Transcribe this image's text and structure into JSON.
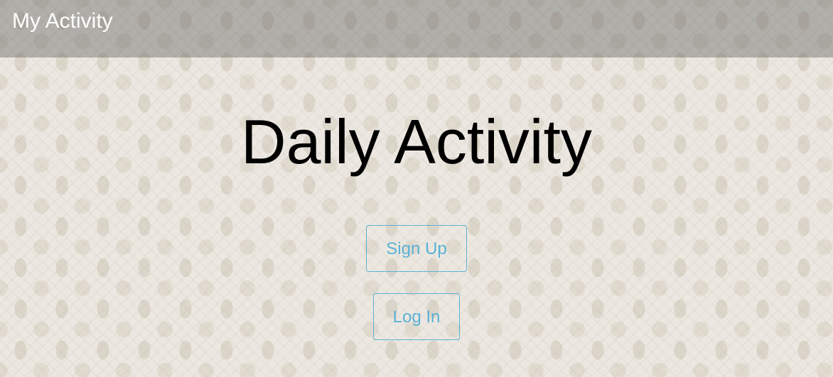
{
  "navbar": {
    "brand": "My Activity"
  },
  "hero": {
    "title": "Daily Activity"
  },
  "actions": {
    "signup_label": "Sign Up",
    "login_label": "Log In"
  },
  "colors": {
    "accent": "#5bb1d6",
    "navbar_bg": "#8a8a8a",
    "title_text": "#000000"
  }
}
